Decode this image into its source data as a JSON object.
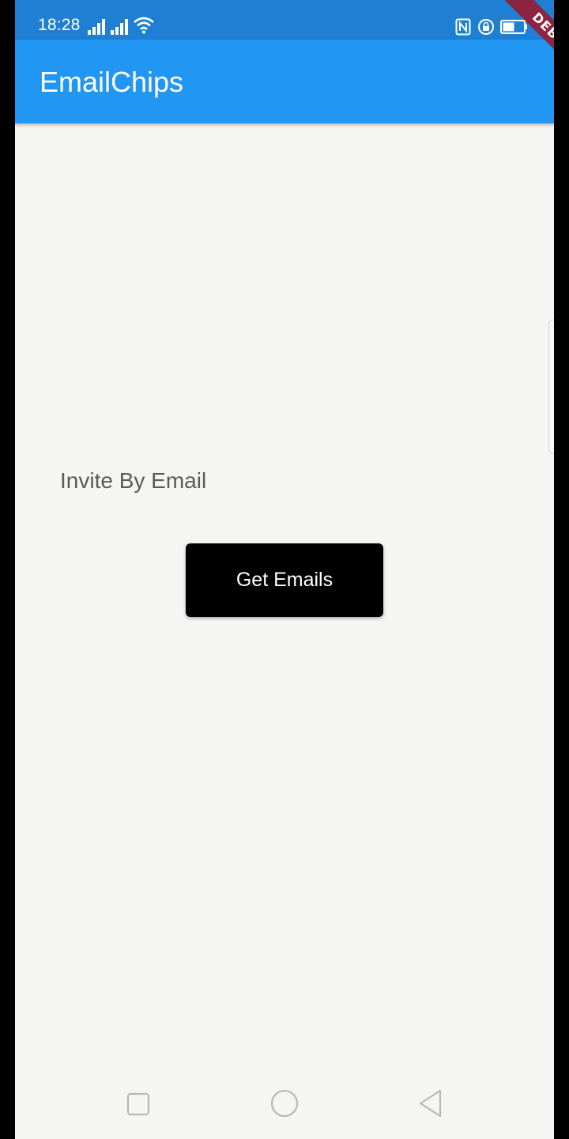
{
  "status_bar": {
    "time": "18:28",
    "background": "#1f7fd3",
    "icons": [
      "signal-icon",
      "signal-icon",
      "wifi-icon",
      "nfc-icon",
      "rotation-lock-icon",
      "battery-icon"
    ]
  },
  "app_bar": {
    "title": "EmailChips",
    "background": "#2196f3"
  },
  "debug_banner": {
    "label": "DEBUG"
  },
  "main": {
    "invite_label": "Invite By Email",
    "get_emails_button": "Get Emails",
    "button_color": "#000000"
  },
  "nav_bar": {
    "buttons": [
      "recents-icon",
      "home-icon",
      "back-icon"
    ]
  }
}
